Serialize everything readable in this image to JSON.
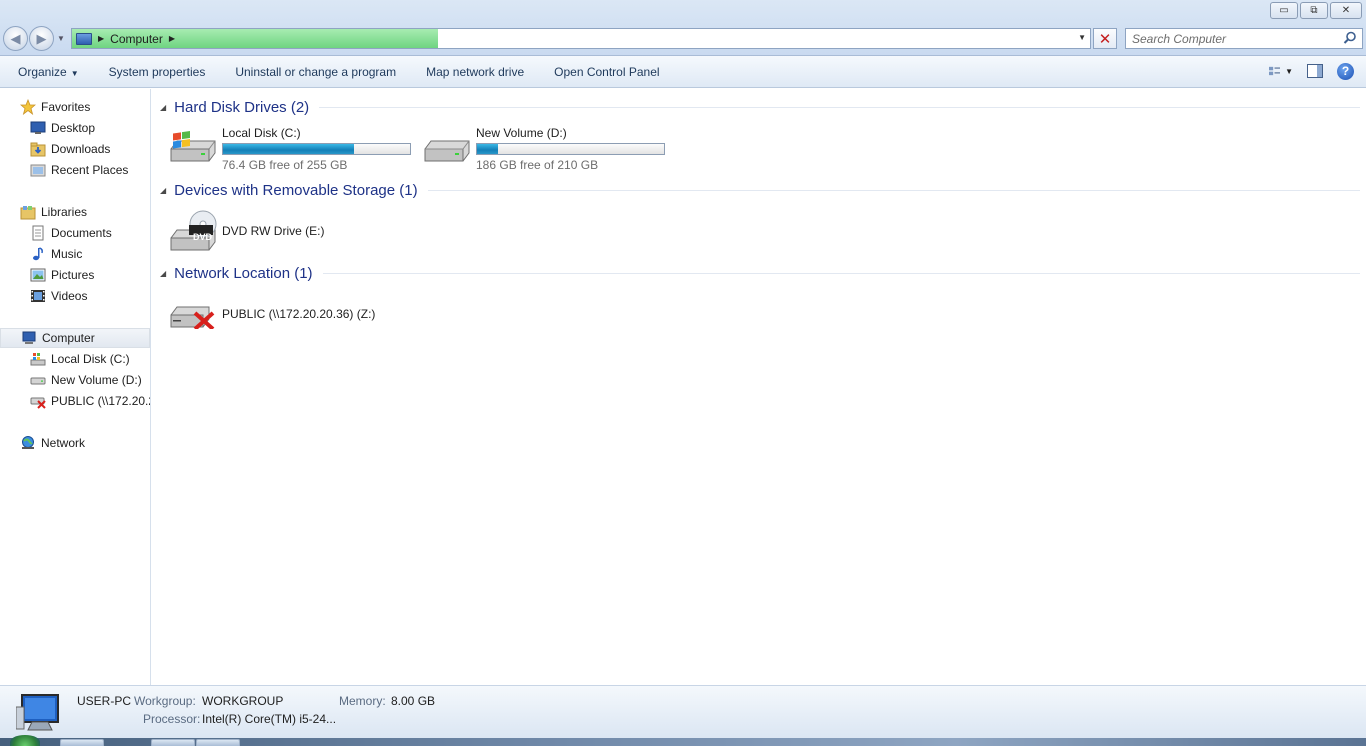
{
  "window": {
    "controls": {
      "minimize": "▭",
      "maximize": "⧉",
      "close": "✕"
    }
  },
  "address_bar": {
    "location": "Computer",
    "progress_percent": 36
  },
  "search": {
    "placeholder": "Search Computer"
  },
  "toolbar": {
    "organize": "Organize",
    "system_properties": "System properties",
    "uninstall": "Uninstall or change a program",
    "map_drive": "Map network drive",
    "control_panel": "Open Control Panel"
  },
  "nav": {
    "favorites": "Favorites",
    "desktop": "Desktop",
    "downloads": "Downloads",
    "recent": "Recent Places",
    "libraries": "Libraries",
    "documents": "Documents",
    "music": "Music",
    "pictures": "Pictures",
    "videos": "Videos",
    "computer": "Computer",
    "local_disk": "Local Disk (C:)",
    "new_volume": "New Volume (D:)",
    "public": "PUBLIC (\\\\172.20.2",
    "network": "Network"
  },
  "groups": {
    "hdd": "Hard Disk Drives (2)",
    "removable": "Devices with Removable Storage (1)",
    "network": "Network Location (1)"
  },
  "drives": {
    "c": {
      "name": "Local Disk (C:)",
      "free": "76.4 GB free of 255 GB",
      "used_fraction": 0.7
    },
    "d": {
      "name": "New Volume (D:)",
      "free": "186 GB free of 210 GB",
      "used_fraction": 0.11
    },
    "e": {
      "name": "DVD RW Drive (E:)",
      "badge": "DVD"
    },
    "z": {
      "name": "PUBLIC (\\\\172.20.20.36) (Z:)"
    }
  },
  "details": {
    "pc_name": "USER-PC",
    "workgroup_label": "Workgroup:",
    "workgroup_value": "WORKGROUP",
    "memory_label": "Memory:",
    "memory_value": "8.00 GB",
    "processor_label": "Processor:",
    "processor_value": "Intel(R) Core(TM) i5-24..."
  },
  "colors": {
    "group_title": "#1e3287",
    "drive_fill": "#1a8fc6",
    "address_progress": "#6fd481"
  }
}
